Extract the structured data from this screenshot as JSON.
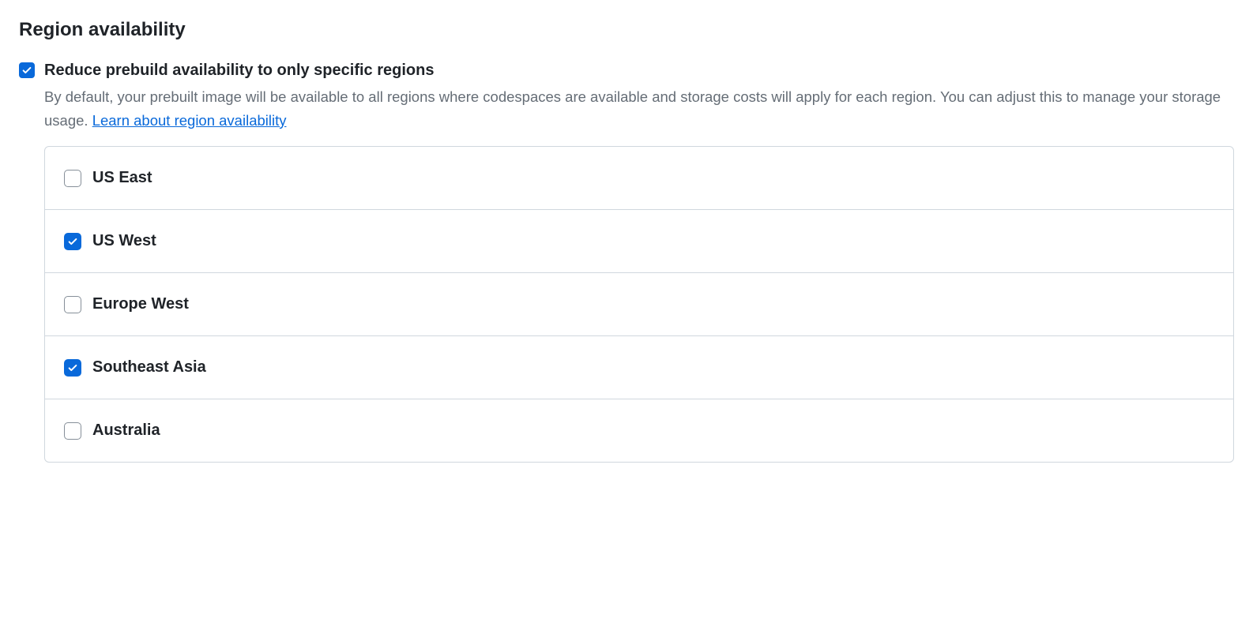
{
  "section": {
    "title": "Region availability"
  },
  "mainOption": {
    "label": "Reduce prebuild availability to only specific regions",
    "checked": true,
    "description": "By default, your prebuilt image will be available to all regions where codespaces are available and storage costs will apply for each region. You can adjust this to manage your storage usage. ",
    "linkText": "Learn about region availability"
  },
  "regions": [
    {
      "label": "US East",
      "checked": false
    },
    {
      "label": "US West",
      "checked": true
    },
    {
      "label": "Europe West",
      "checked": false
    },
    {
      "label": "Southeast Asia",
      "checked": true
    },
    {
      "label": "Australia",
      "checked": false
    }
  ]
}
